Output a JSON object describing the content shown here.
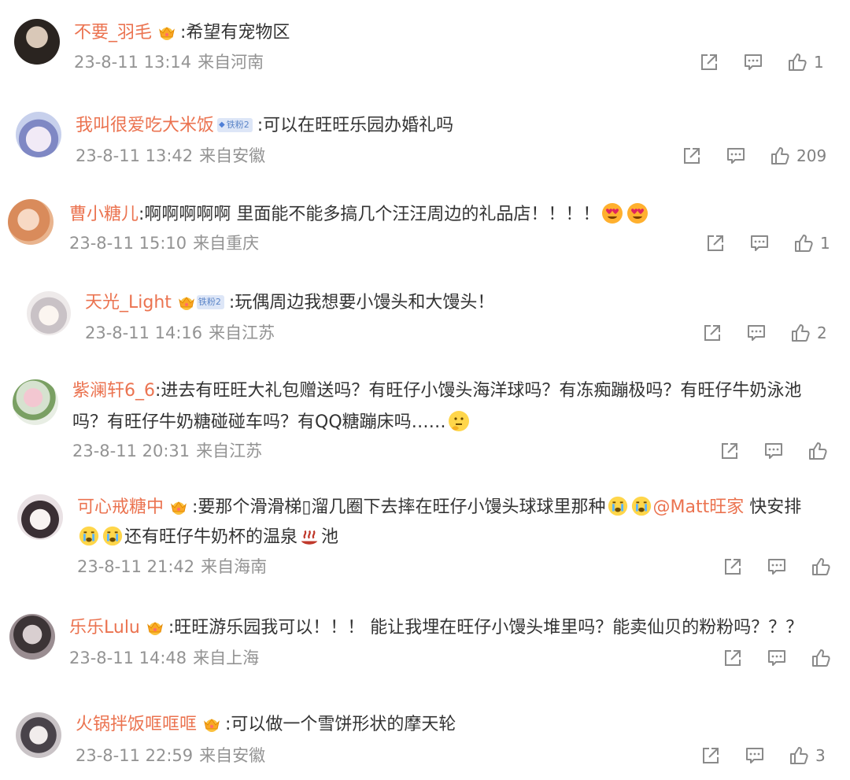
{
  "comments": [
    {
      "user": "不要_羽毛",
      "badge": "crown",
      "content": ":希望有宠物区",
      "time": "23-8-11 13:14",
      "location": "来自河南",
      "likes": "1"
    },
    {
      "user": "我叫很爱吃大米饭",
      "badge": "铁粉2",
      "content": ":可以在旺旺乐园办婚礼吗",
      "time": "23-8-11 13:42",
      "location": "来自安徽",
      "likes": "209"
    },
    {
      "user": "曹小糖儿",
      "content": ":啊啊啊啊啊 里面能不能多搞几个汪汪周边的礼品店！！！！",
      "emojis": [
        "heart-eyes-emoji",
        "heart-eyes-emoji"
      ],
      "time": "23-8-11 15:10",
      "location": "来自重庆",
      "likes": "1"
    },
    {
      "user": "天光_Light",
      "badge": "crown+铁粉2",
      "badge_text": "铁粉2",
      "content": ":玩偶周边我想要小馒头和大馒头！",
      "time": "23-8-11 14:16",
      "location": "来自江苏",
      "likes": "2"
    },
    {
      "user": "紫澜轩6_6",
      "content_line1": ":进去有旺旺大礼包赠送吗？有旺仔小馒头海洋球吗？有冻痴蹦极吗？有旺仔牛奶泳池",
      "content_line2": "吗？有旺仔牛奶糖碰碰车吗？有QQ糖蹦床吗……",
      "emojis": [
        "thinking-emoji"
      ],
      "time": "23-8-11 20:31",
      "location": "来自江苏",
      "likes": ""
    },
    {
      "user": "可心戒糖中",
      "badge": "crown",
      "content_line1": ":要那个滑滑梯▯溜几圈下去摔在旺仔小馒头球球里那种",
      "mention": "@Matt旺家",
      "content_line1_tail": " 快安排",
      "content_line2": "还有旺仔牛奶杯的温泉",
      "content_line2_tail": "池",
      "emojis": [
        "crying-emoji",
        "crying-emoji",
        "crying-emoji",
        "crying-emoji",
        "hot-springs-emoji"
      ],
      "time": "23-8-11 21:42",
      "location": "来自海南",
      "likes": ""
    },
    {
      "user": "乐乐Lulu",
      "badge": "crown",
      "content": ":旺旺游乐园我可以！！！ 能让我埋在旺仔小馒头堆里吗？能卖仙贝的粉粉吗？？？",
      "time": "23-8-11 14:48",
      "location": "来自上海",
      "likes": ""
    },
    {
      "user": "火锅拌饭哐哐哐",
      "badge": "crown",
      "content": ":可以做一个雪饼形状的摩天轮",
      "time": "23-8-11 22:59",
      "location": "来自安徽",
      "likes": "3"
    }
  ],
  "icons": {
    "share": "share-icon",
    "comment": "comment-icon",
    "like": "like-icon",
    "crown": "crown-badge-icon",
    "fan": "diamond-icon"
  },
  "colors": {
    "username": "#eb7350",
    "text": "#333333",
    "meta": "#939393",
    "icon": "#8a8a8a"
  }
}
